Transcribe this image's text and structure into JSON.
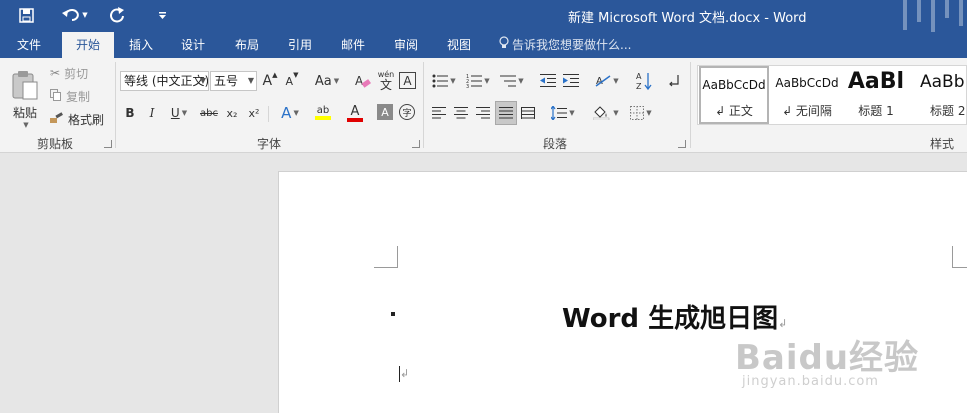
{
  "window": {
    "title": "新建 Microsoft Word 文档.docx  -  Word"
  },
  "qat": {
    "save_icon": "save-icon",
    "undo_icon": "undo-icon",
    "redo_icon": "redo-icon",
    "customize_icon": "customize-icon"
  },
  "tabs": [
    {
      "label": "文件"
    },
    {
      "label": "开始"
    },
    {
      "label": "插入"
    },
    {
      "label": "设计"
    },
    {
      "label": "布局"
    },
    {
      "label": "引用"
    },
    {
      "label": "邮件"
    },
    {
      "label": "审阅"
    },
    {
      "label": "视图"
    }
  ],
  "tellme": {
    "label": "告诉我您想要做什么..."
  },
  "clipboard": {
    "paste_label": "粘贴",
    "cut_label": "剪切",
    "copy_label": "复制",
    "format_painter_label": "格式刷",
    "group_label": "剪贴板"
  },
  "font": {
    "font_name": "等线 (中文正文)",
    "font_size": "五号",
    "grow_label": "A",
    "shrink_label": "A",
    "case_label": "Aa",
    "pinyin_top": "wén",
    "pinyin_char": "文",
    "border_char": "A",
    "bold": "B",
    "italic": "I",
    "underline": "U",
    "strike": "abc",
    "sub": "x₂",
    "sup": "x²",
    "effects": "A",
    "highlight": "ab",
    "color": "A",
    "shade": "A",
    "enclose": "字",
    "group_label": "字体"
  },
  "paragraph": {
    "sort_label": "A↓Z",
    "group_label": "段落"
  },
  "styles": {
    "items": [
      {
        "preview": "AaBbCcDd",
        "name": "↲ 正文"
      },
      {
        "preview": "AaBbCcDd",
        "name": "↲ 无间隔"
      },
      {
        "preview": "AaBl",
        "name": "标题 1"
      },
      {
        "preview": "AaBb",
        "name": "标题 2"
      }
    ],
    "group_label": "样式"
  },
  "document": {
    "title": "Word 生成旭日图",
    "para_mark": "↲"
  },
  "watermark": {
    "main": "Baidu经验",
    "sub": "jingyan.baidu.com"
  },
  "colors": {
    "brand": "#2b579a",
    "highlight": "#ffff00",
    "font_color": "#e00000"
  }
}
